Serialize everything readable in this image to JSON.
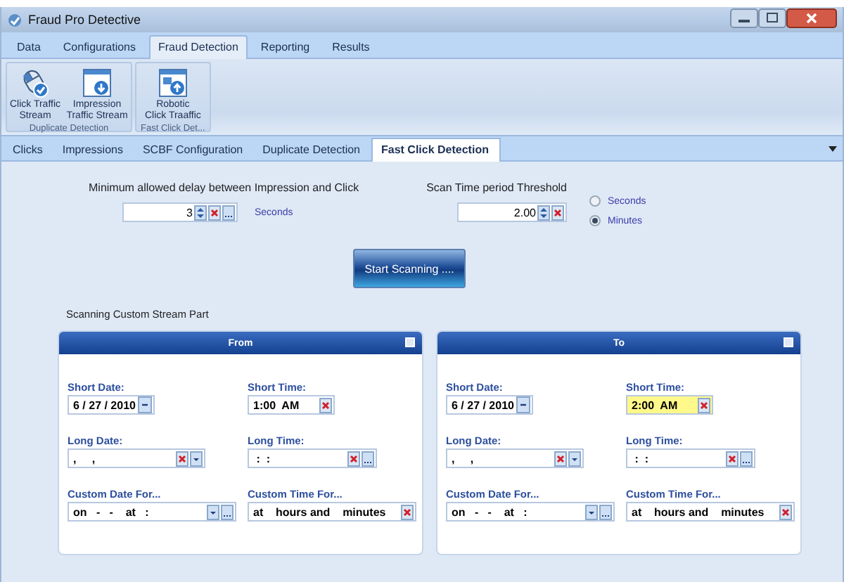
{
  "window": {
    "title": "Fraud Pro Detective"
  },
  "menu_tabs": [
    {
      "label": "Data",
      "selected": false
    },
    {
      "label": "Configurations",
      "selected": false
    },
    {
      "label": "Fraud Detection",
      "selected": true
    },
    {
      "label": "Reporting",
      "selected": false
    },
    {
      "label": "Results",
      "selected": false
    }
  ],
  "ribbon_groups": [
    {
      "caption": "Duplicate Detection",
      "buttons": [
        {
          "kind": "mouse",
          "label": "Click Traffic Stream"
        },
        {
          "kind": "download",
          "label": "Impression Traffic Stream"
        }
      ]
    },
    {
      "caption": "Fast Click Det...",
      "buttons": [
        {
          "kind": "upload",
          "label": "Robotic Click Traaffic"
        }
      ]
    }
  ],
  "doc_tabs": [
    {
      "label": "Clicks",
      "selected": false
    },
    {
      "label": "Impressions",
      "selected": false
    },
    {
      "label": "SCBF Configuration",
      "selected": false
    },
    {
      "label": "Duplicate Detection",
      "selected": false
    },
    {
      "label": "Fast Click Detection",
      "selected": true
    }
  ],
  "settings": {
    "delay": {
      "label": "Minimum allowed delay between Impression and Click",
      "value": "3",
      "unit": "Seconds"
    },
    "threshold": {
      "label": "Scan Time period Threshold",
      "value": "2.00"
    },
    "units": [
      {
        "label": "Seconds",
        "selected": false
      },
      {
        "label": "Minutes",
        "selected": true
      }
    ],
    "start_button": "Start Scanning ....",
    "section_label": "Scanning Custom Stream Part"
  },
  "panels": [
    {
      "title": "From",
      "fields": [
        {
          "kind": "short-date",
          "label": "Short Date:",
          "value": "6 / 27 / 2010",
          "focused": false
        },
        {
          "kind": "short-time",
          "label": "Short Time:",
          "value": "1:00  AM",
          "focused": false
        },
        {
          "kind": "long-date",
          "label": "Long Date:",
          "value": ",     ,",
          "focused": false
        },
        {
          "kind": "long-time",
          "label": "Long Time:",
          "value": " :  :",
          "focused": false
        },
        {
          "kind": "custom-date",
          "label": "Custom Date For...",
          "value": "on   -   -    at   :",
          "focused": false
        },
        {
          "kind": "custom-time",
          "label": "Custom Time For...",
          "value": "at    hours and    minutes",
          "focused": false
        }
      ]
    },
    {
      "title": "To",
      "fields": [
        {
          "kind": "short-date",
          "label": "Short Date:",
          "value": "6 / 27 / 2010",
          "focused": false
        },
        {
          "kind": "short-time",
          "label": "Short Time:",
          "value": "2:00  AM",
          "focused": true
        },
        {
          "kind": "long-date",
          "label": "Long Date:",
          "value": ",     ,",
          "focused": false
        },
        {
          "kind": "long-time",
          "label": "Long Time:",
          "value": " :  :",
          "focused": false
        },
        {
          "kind": "custom-date",
          "label": "Custom Date For...",
          "value": "on   -   -    at   :",
          "focused": false
        },
        {
          "kind": "custom-time",
          "label": "Custom Time For...",
          "value": "at    hours and    minutes",
          "focused": false
        }
      ]
    }
  ]
}
